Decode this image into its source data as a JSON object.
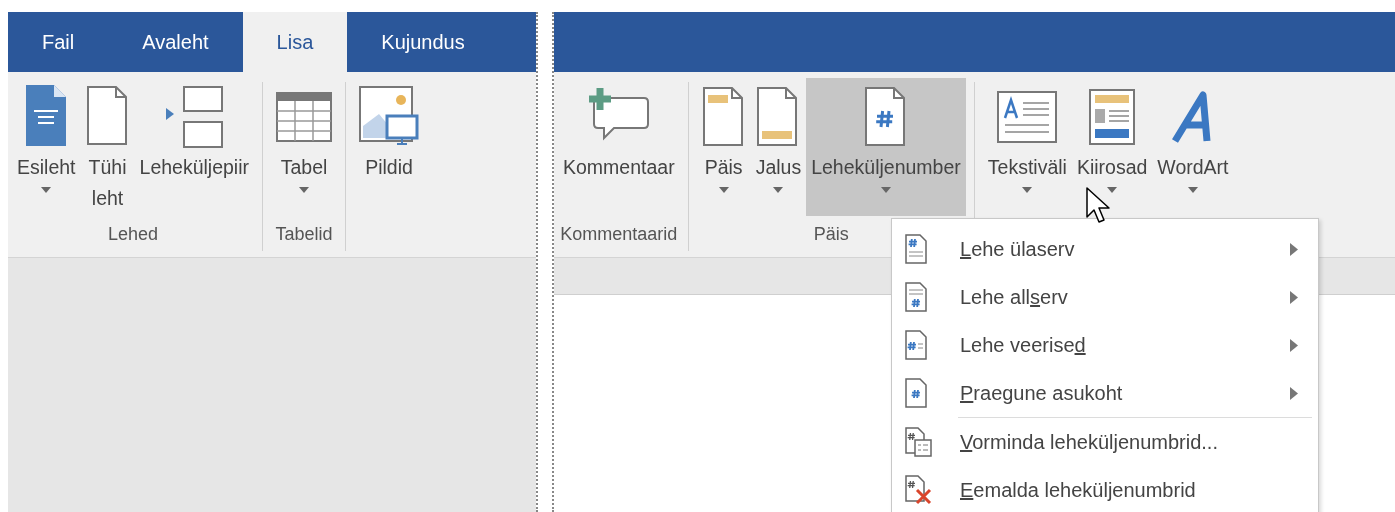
{
  "tabs": [
    {
      "label": "Fail",
      "selected": false
    },
    {
      "label": "Avaleht",
      "selected": false
    },
    {
      "label": "Lisa",
      "selected": true
    },
    {
      "label": "Kujundus",
      "selected": false
    }
  ],
  "left_ribbon": {
    "groups": [
      {
        "label": "Lehed",
        "buttons": [
          {
            "label": "Esileht",
            "dropdown": true,
            "expanded": false
          },
          {
            "label": "Tühi leht",
            "dropdown": false,
            "expanded": false
          },
          {
            "label": "Leheküljepiir",
            "dropdown": false,
            "expanded": false
          }
        ]
      },
      {
        "label": "Tabelid",
        "buttons": [
          {
            "label": "Tabel",
            "dropdown": true,
            "expanded": false
          }
        ]
      },
      {
        "buttons": [
          {
            "label": "Pildid",
            "dropdown": false,
            "expanded": false
          }
        ]
      }
    ]
  },
  "right_ribbon": {
    "groups": [
      {
        "label": "Kommentaarid",
        "buttons": [
          {
            "label": "Kommentaar",
            "dropdown": false,
            "expanded": false
          }
        ]
      },
      {
        "label": "Päis",
        "buttons": [
          {
            "label": "Päis",
            "dropdown": true,
            "expanded": false
          },
          {
            "label": "Jalus",
            "dropdown": true,
            "expanded": false
          },
          {
            "label": "Leheküljenumber",
            "dropdown": true,
            "expanded": true
          }
        ]
      },
      {
        "buttons": [
          {
            "label": "Tekstiväli",
            "dropdown": true,
            "expanded": false
          },
          {
            "label": "Kiirosad",
            "dropdown": true,
            "expanded": false
          },
          {
            "label": "WordArt",
            "dropdown": true,
            "expanded": false
          }
        ]
      }
    ]
  },
  "menu": {
    "items": [
      {
        "kind": "item",
        "mnemonic": "L",
        "after": "ehe ülaserv",
        "submenu": true
      },
      {
        "kind": "item",
        "before": "Lehe all",
        "mnemonic": "s",
        "after": "erv",
        "submenu": true
      },
      {
        "kind": "item",
        "before": "Lehe veerise",
        "mnemonic": "d",
        "submenu": true
      },
      {
        "kind": "item",
        "mnemonic": "P",
        "after": "raegune asukoht",
        "submenu": true
      },
      {
        "kind": "separator"
      },
      {
        "kind": "item",
        "mnemonic": "V",
        "after": "orminda leheküljenumbrid...",
        "submenu": false
      },
      {
        "kind": "item",
        "mnemonic": "E",
        "after": "emalda leheküljenumbrid",
        "submenu": false
      }
    ]
  }
}
